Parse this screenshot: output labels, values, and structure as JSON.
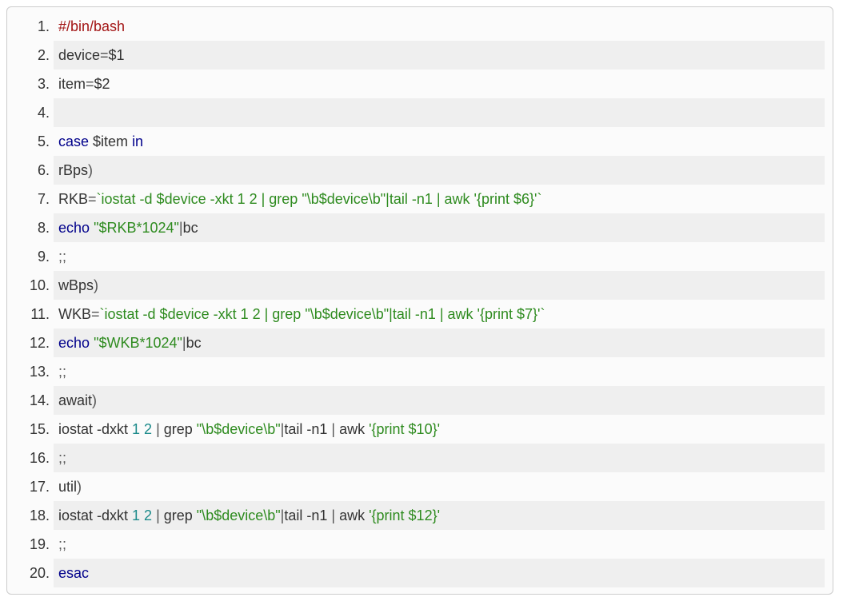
{
  "code": {
    "lines": [
      [
        {
          "cls": "tok-red",
          "text": "#/bin/bash"
        }
      ],
      [
        {
          "cls": "tok-plain",
          "text": "device"
        },
        {
          "cls": "tok-punct",
          "text": "="
        },
        {
          "cls": "tok-plain",
          "text": "$1"
        }
      ],
      [
        {
          "cls": "tok-plain",
          "text": "item"
        },
        {
          "cls": "tok-punct",
          "text": "="
        },
        {
          "cls": "tok-plain",
          "text": "$2"
        }
      ],
      [
        {
          "cls": "tok-plain",
          "text": " "
        }
      ],
      [
        {
          "cls": "tok-darkblue",
          "text": "case"
        },
        {
          "cls": "tok-plain",
          "text": " $item "
        },
        {
          "cls": "tok-darkblue",
          "text": "in"
        }
      ],
      [
        {
          "cls": "tok-plain",
          "text": "rBps"
        },
        {
          "cls": "tok-punct",
          "text": ")"
        }
      ],
      [
        {
          "cls": "tok-plain",
          "text": "RKB"
        },
        {
          "cls": "tok-punct",
          "text": "="
        },
        {
          "cls": "tok-green",
          "text": "`iostat -d $device -xkt 1 2 | grep \"\\b$device\\b\"|tail -n1 | awk '{print $6}'`"
        }
      ],
      [
        {
          "cls": "tok-darkblue",
          "text": "echo"
        },
        {
          "cls": "tok-plain",
          "text": " "
        },
        {
          "cls": "tok-green",
          "text": "\"$RKB*1024\""
        },
        {
          "cls": "tok-punct",
          "text": "|"
        },
        {
          "cls": "tok-plain",
          "text": "bc"
        }
      ],
      [
        {
          "cls": "tok-punct",
          "text": ";;"
        }
      ],
      [
        {
          "cls": "tok-plain",
          "text": "wBps"
        },
        {
          "cls": "tok-punct",
          "text": ")"
        }
      ],
      [
        {
          "cls": "tok-plain",
          "text": "WKB"
        },
        {
          "cls": "tok-punct",
          "text": "="
        },
        {
          "cls": "tok-green",
          "text": "`iostat -d $device -xkt 1 2 | grep \"\\b$device\\b\"|tail -n1 | awk '{print $7}'`"
        }
      ],
      [
        {
          "cls": "tok-darkblue",
          "text": "echo"
        },
        {
          "cls": "tok-plain",
          "text": " "
        },
        {
          "cls": "tok-green",
          "text": "\"$WKB*1024\""
        },
        {
          "cls": "tok-punct",
          "text": "|"
        },
        {
          "cls": "tok-plain",
          "text": "bc"
        }
      ],
      [
        {
          "cls": "tok-punct",
          "text": ";;"
        }
      ],
      [
        {
          "cls": "tok-plain",
          "text": "await"
        },
        {
          "cls": "tok-punct",
          "text": ")"
        }
      ],
      [
        {
          "cls": "tok-plain",
          "text": "iostat -dxkt "
        },
        {
          "cls": "tok-teal",
          "text": "1 2"
        },
        {
          "cls": "tok-plain",
          "text": " "
        },
        {
          "cls": "tok-punct",
          "text": "|"
        },
        {
          "cls": "tok-plain",
          "text": " grep "
        },
        {
          "cls": "tok-green",
          "text": "\"\\b$device\\b\""
        },
        {
          "cls": "tok-punct",
          "text": "|"
        },
        {
          "cls": "tok-plain",
          "text": "tail -n1 "
        },
        {
          "cls": "tok-punct",
          "text": "|"
        },
        {
          "cls": "tok-plain",
          "text": " awk "
        },
        {
          "cls": "tok-green",
          "text": "'{print $10}'"
        }
      ],
      [
        {
          "cls": "tok-punct",
          "text": ";;"
        }
      ],
      [
        {
          "cls": "tok-plain",
          "text": "util"
        },
        {
          "cls": "tok-punct",
          "text": ")"
        }
      ],
      [
        {
          "cls": "tok-plain",
          "text": "iostat -dxkt "
        },
        {
          "cls": "tok-teal",
          "text": "1 2"
        },
        {
          "cls": "tok-plain",
          "text": " "
        },
        {
          "cls": "tok-punct",
          "text": "|"
        },
        {
          "cls": "tok-plain",
          "text": " grep "
        },
        {
          "cls": "tok-green",
          "text": "\"\\b$device\\b\""
        },
        {
          "cls": "tok-punct",
          "text": "|"
        },
        {
          "cls": "tok-plain",
          "text": "tail -n1 "
        },
        {
          "cls": "tok-punct",
          "text": "|"
        },
        {
          "cls": "tok-plain",
          "text": " awk "
        },
        {
          "cls": "tok-green",
          "text": "'{print $12}'"
        }
      ],
      [
        {
          "cls": "tok-punct",
          "text": ";;"
        }
      ],
      [
        {
          "cls": "tok-darkblue",
          "text": "esac"
        }
      ]
    ]
  }
}
